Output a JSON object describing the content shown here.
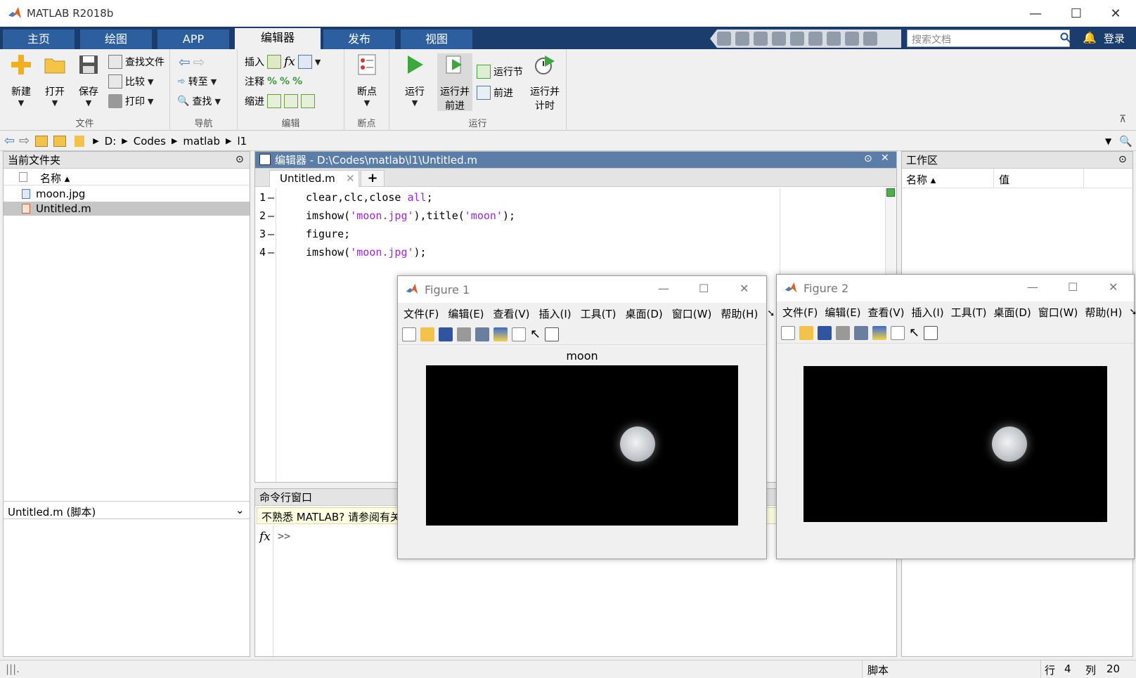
{
  "window": {
    "title": "MATLAB R2018b",
    "minimize": "—",
    "maximize": "☐",
    "close": "✕"
  },
  "tabs": [
    {
      "label": "主页"
    },
    {
      "label": "绘图"
    },
    {
      "label": "APP"
    },
    {
      "label": "编辑器"
    },
    {
      "label": "发布"
    },
    {
      "label": "视图"
    }
  ],
  "search": {
    "placeholder": "搜索文档"
  },
  "login_label": "登录",
  "ribbon": {
    "file": {
      "label": "文件",
      "new": "新建",
      "open": "打开",
      "save": "保存",
      "find_files": "查找文件",
      "compare": "比较",
      "print": "打印"
    },
    "navigate": {
      "label": "导航",
      "goto": "转至",
      "find": "查找"
    },
    "edit": {
      "label": "编辑",
      "insert": "插入",
      "comment": "注释",
      "indent": "缩进",
      "fx": "fx"
    },
    "breakpoints": {
      "label": "断点",
      "breakpoint": "断点"
    },
    "run": {
      "label": "运行",
      "run": "运行",
      "run_advance_1": "运行并",
      "run_advance_2": "前进",
      "run_section": "运行节",
      "advance": "前进",
      "run_time_1": "运行并",
      "run_time_2": "计时"
    }
  },
  "path": [
    "D:",
    "Codes",
    "matlab",
    "l1"
  ],
  "current_folder": {
    "title": "当前文件夹",
    "col_name": "名称 ▴",
    "files": [
      {
        "name": "moon.jpg"
      },
      {
        "name": "Untitled.m"
      }
    ],
    "details": "Untitled.m  (脚本)"
  },
  "editor": {
    "title": "编辑器 - D:\\Codes\\matlab\\l1\\Untitled.m",
    "tab": "Untitled.m",
    "add_tab": "+",
    "lines": [
      {
        "num": "1",
        "dash": "—"
      },
      {
        "num": "2",
        "dash": "—"
      },
      {
        "num": "3",
        "dash": "—"
      },
      {
        "num": "4",
        "dash": "—"
      }
    ],
    "code": {
      "l1a": "clear,clc,close ",
      "l1b": "all",
      "l1c": ";",
      "l2a": "imshow(",
      "l2b": "'moon.jpg'",
      "l2c": "),title(",
      "l2d": "'moon'",
      "l2e": ");",
      "l3a": "figure;",
      "l4a": "imshow(",
      "l4b": "'moon.jpg'",
      "l4c": ");"
    }
  },
  "command_window": {
    "title": "命令行窗口",
    "notice": "不熟悉 MATLAB? 请参阅有关",
    "fx": "fx",
    "prompt": ">>"
  },
  "workspace": {
    "title": "工作区",
    "col_name": "名称 ▴",
    "col_value": "值"
  },
  "figure_menu": [
    "文件(F)",
    "编辑(E)",
    "查看(V)",
    "插入(I)",
    "工具(T)",
    "桌面(D)",
    "窗口(W)",
    "帮助(H)"
  ],
  "figure1": {
    "title": "Figure 1",
    "axes_title": "moon"
  },
  "figure2": {
    "title": "Figure 2"
  },
  "statusbar": {
    "type": "脚本",
    "row_label": "行",
    "row": "4",
    "col_label": "列",
    "col": "20"
  },
  "colors": {
    "tab_bg": "#1a3d6e",
    "tab": "#2d5f9f",
    "string": "#a020f0",
    "keyword": "#a020f0"
  }
}
